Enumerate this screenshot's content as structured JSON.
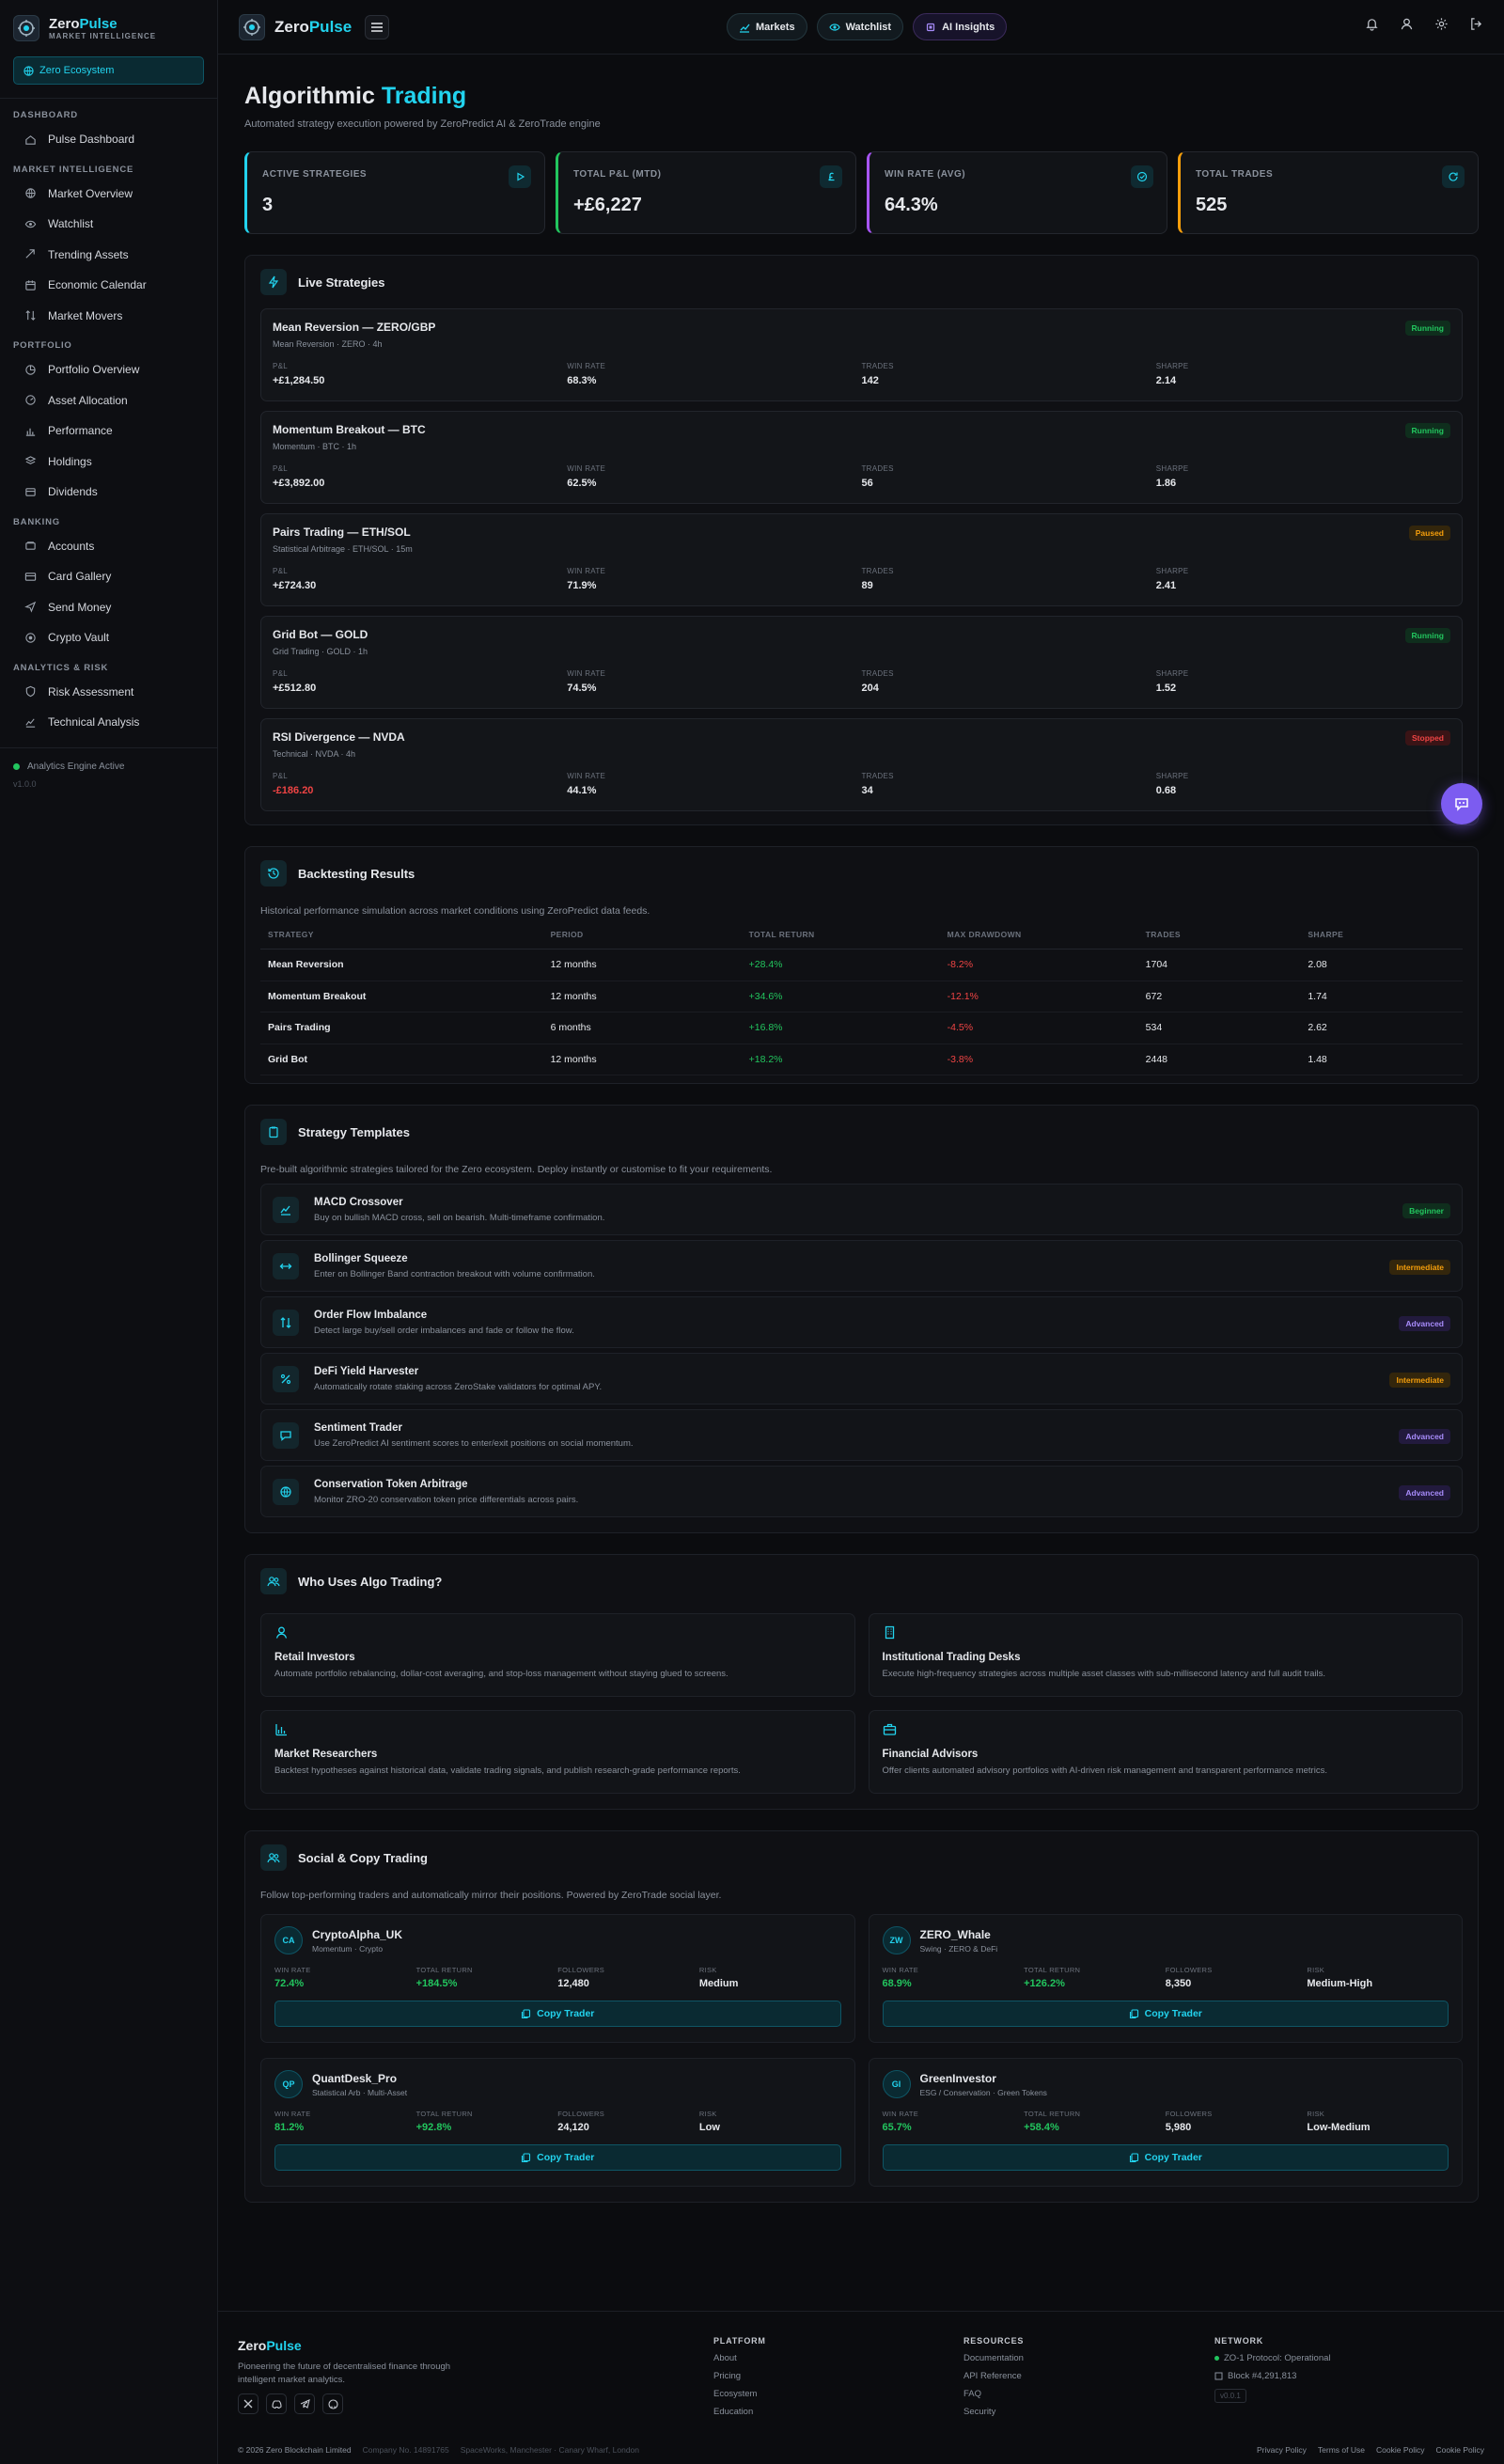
{
  "brand": {
    "name_a": "Zero",
    "name_b": "Pulse",
    "subtitle": "MARKET INTELLIGENCE",
    "ecosystem": "Zero Ecosystem"
  },
  "sidebar": {
    "sections": [
      {
        "title": "DASHBOARD",
        "items": [
          "Pulse Dashboard"
        ]
      },
      {
        "title": "MARKET INTELLIGENCE",
        "items": [
          "Market Overview",
          "Watchlist",
          "Trending Assets",
          "Economic Calendar",
          "Market Movers"
        ]
      },
      {
        "title": "PORTFOLIO",
        "items": [
          "Portfolio Overview",
          "Asset Allocation",
          "Performance",
          "Holdings",
          "Dividends"
        ]
      },
      {
        "title": "BANKING",
        "items": [
          "Accounts",
          "Card Gallery",
          "Send Money",
          "Crypto Vault"
        ]
      },
      {
        "title": "ANALYTICS & RISK",
        "items": [
          "Risk Assessment",
          "Technical Analysis"
        ]
      }
    ],
    "status": "Analytics Engine Active",
    "version": "v1.0.0"
  },
  "header": {
    "pills": [
      "Markets",
      "Watchlist",
      "AI Insights"
    ]
  },
  "page": {
    "title_a": "Algorithmic",
    "title_b": "Trading",
    "subtitle": "Automated strategy execution powered by ZeroPredict AI & ZeroTrade engine"
  },
  "stats": [
    {
      "label": "ACTIVE STRATEGIES",
      "value": "3",
      "color": "#22d3ee"
    },
    {
      "label": "TOTAL P&L (MTD)",
      "value": "+£6,227",
      "color": "#22c55e"
    },
    {
      "label": "WIN RATE (AVG)",
      "value": "64.3%",
      "color": "#a855f7"
    },
    {
      "label": "TOTAL TRADES",
      "value": "525",
      "color": "#f59e0b"
    }
  ],
  "live": {
    "title": "Live Strategies",
    "col_labels": [
      "P&L",
      "WIN RATE",
      "TRADES",
      "SHARPE"
    ],
    "items": [
      {
        "name": "Mean Reversion — ZERO/GBP",
        "meta": "Mean Reversion · ZERO · 4h",
        "status": "Running",
        "pnl": "+£1,284.50",
        "win": "68.3%",
        "trades": "142",
        "sharpe": "2.14",
        "neg": false
      },
      {
        "name": "Momentum Breakout — BTC",
        "meta": "Momentum · BTC · 1h",
        "status": "Running",
        "pnl": "+£3,892.00",
        "win": "62.5%",
        "trades": "56",
        "sharpe": "1.86",
        "neg": false
      },
      {
        "name": "Pairs Trading — ETH/SOL",
        "meta": "Statistical Arbitrage · ETH/SOL · 15m",
        "status": "Paused",
        "pnl": "+£724.30",
        "win": "71.9%",
        "trades": "89",
        "sharpe": "2.41",
        "neg": false
      },
      {
        "name": "Grid Bot — GOLD",
        "meta": "Grid Trading · GOLD · 1h",
        "status": "Running",
        "pnl": "+£512.80",
        "win": "74.5%",
        "trades": "204",
        "sharpe": "1.52",
        "neg": false
      },
      {
        "name": "RSI Divergence — NVDA",
        "meta": "Technical · NVDA · 4h",
        "status": "Stopped",
        "pnl": "-£186.20",
        "win": "44.1%",
        "trades": "34",
        "sharpe": "0.68",
        "neg": true
      }
    ]
  },
  "backtest": {
    "title": "Backtesting Results",
    "desc": "Historical performance simulation across market conditions using ZeroPredict data feeds.",
    "headers": [
      "STRATEGY",
      "PERIOD",
      "TOTAL RETURN",
      "MAX DRAWDOWN",
      "TRADES",
      "SHARPE"
    ],
    "rows": [
      [
        "Mean Reversion",
        "12 months",
        "+28.4%",
        "-8.2%",
        "1704",
        "2.08"
      ],
      [
        "Momentum Breakout",
        "12 months",
        "+34.6%",
        "-12.1%",
        "672",
        "1.74"
      ],
      [
        "Pairs Trading",
        "6 months",
        "+16.8%",
        "-4.5%",
        "534",
        "2.62"
      ],
      [
        "Grid Bot",
        "12 months",
        "+18.2%",
        "-3.8%",
        "2448",
        "1.48"
      ]
    ]
  },
  "templates": {
    "title": "Strategy Templates",
    "desc": "Pre-built algorithmic strategies tailored for the Zero ecosystem. Deploy instantly or customise to fit your requirements.",
    "items": [
      {
        "name": "MACD Crossover",
        "desc": "Buy on bullish MACD cross, sell on bearish. Multi-timeframe confirmation.",
        "level": "Beginner",
        "icon": "chart-line-icon"
      },
      {
        "name": "Bollinger Squeeze",
        "desc": "Enter on Bollinger Band contraction breakout with volume confirmation.",
        "level": "Intermediate",
        "icon": "arrows-horizontal-icon"
      },
      {
        "name": "Order Flow Imbalance",
        "desc": "Detect large buy/sell order imbalances and fade or follow the flow.",
        "level": "Advanced",
        "icon": "arrows-vertical-icon"
      },
      {
        "name": "DeFi Yield Harvester",
        "desc": "Automatically rotate staking across ZeroStake validators for optimal APY.",
        "level": "Intermediate",
        "icon": "percent-icon"
      },
      {
        "name": "Sentiment Trader",
        "desc": "Use ZeroPredict AI sentiment scores to enter/exit positions on social momentum.",
        "level": "Advanced",
        "icon": "chat-icon"
      },
      {
        "name": "Conservation Token Arbitrage",
        "desc": "Monitor ZRO-20 conservation token price differentials across pairs.",
        "level": "Advanced",
        "icon": "globe-icon"
      }
    ]
  },
  "who": {
    "title": "Who Uses Algo Trading?",
    "items": [
      {
        "title": "Retail Investors",
        "desc": "Automate portfolio rebalancing, dollar-cost averaging, and stop-loss management without staying glued to screens.",
        "icon": "user-icon"
      },
      {
        "title": "Institutional Trading Desks",
        "desc": "Execute high-frequency strategies across multiple asset classes with sub-millisecond latency and full audit trails.",
        "icon": "building-icon"
      },
      {
        "title": "Market Researchers",
        "desc": "Backtest hypotheses against historical data, validate trading signals, and publish research-grade performance reports.",
        "icon": "bar-chart-icon"
      },
      {
        "title": "Financial Advisors",
        "desc": "Offer clients automated advisory portfolios with AI-driven risk management and transparent performance metrics.",
        "icon": "briefcase-icon"
      }
    ]
  },
  "social": {
    "title": "Social & Copy Trading",
    "desc": "Follow top-performing traders and automatically mirror their positions. Powered by ZeroTrade social layer.",
    "labels": [
      "WIN RATE",
      "TOTAL RETURN",
      "FOLLOWERS",
      "RISK"
    ],
    "button": "Copy Trader",
    "traders": [
      {
        "initials": "CA",
        "name": "CryptoAlpha_UK",
        "style": "Momentum · Crypto",
        "win": "72.4%",
        "ret": "+184.5%",
        "followers": "12,480",
        "risk": "Medium"
      },
      {
        "initials": "ZW",
        "name": "ZERO_Whale",
        "style": "Swing · ZERO & DeFi",
        "win": "68.9%",
        "ret": "+126.2%",
        "followers": "8,350",
        "risk": "Medium-High"
      },
      {
        "initials": "QP",
        "name": "QuantDesk_Pro",
        "style": "Statistical Arb · Multi-Asset",
        "win": "81.2%",
        "ret": "+92.8%",
        "followers": "24,120",
        "risk": "Low"
      },
      {
        "initials": "GI",
        "name": "GreenInvestor",
        "style": "ESG / Conservation · Green Tokens",
        "win": "65.7%",
        "ret": "+58.4%",
        "followers": "5,980",
        "risk": "Low-Medium"
      }
    ]
  },
  "footer": {
    "brand_a": "Zero",
    "brand_b": "Pulse",
    "tagline": "Pioneering the future of decentralised finance through intelligent market analytics.",
    "platform": {
      "title": "PLATFORM",
      "links": [
        "About",
        "Pricing",
        "Ecosystem",
        "Education"
      ]
    },
    "resources": {
      "title": "RESOURCES",
      "links": [
        "Documentation",
        "API Reference",
        "FAQ",
        "Security"
      ]
    },
    "network": {
      "title": "NETWORK",
      "status": "ZO-1 Protocol: Operational",
      "block": "Block #4,291,813",
      "tag": "v0.0.1"
    },
    "copyright": "© 2026 Zero Blockchain Limited",
    "company": "Company No. 14891765",
    "address": "SpaceWorks, Manchester · Canary Wharf, London",
    "legal": [
      "Privacy Policy",
      "Terms of Use",
      "Cookie Policy",
      "Cookie Policy"
    ]
  },
  "colors": {
    "accent": "#22d3ee",
    "positive": "#22c55e",
    "negative": "#ef4444",
    "fab": "#7c5cf0"
  }
}
